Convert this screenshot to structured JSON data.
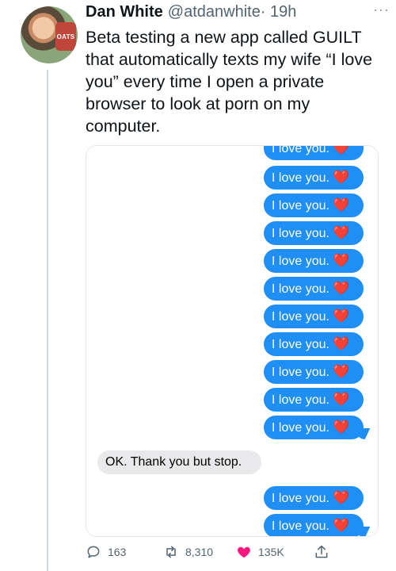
{
  "tweet": {
    "author_name": "Dan White",
    "handle": "@atdanwhite",
    "time": " · 19h",
    "more": "···",
    "text": "Beta testing a new app called GUILT that automatically texts my wife “I love you” every time I open a private browser to look at porn on my computer."
  },
  "avatar": {
    "logo_text": "OATS"
  },
  "messages": {
    "outgoing_text": "I love you.",
    "heart": "❤️",
    "incoming": "OK. Thank you but stop."
  },
  "actions": {
    "replies": "163",
    "retweets": "8,310",
    "likes": "135K"
  },
  "colors": {
    "imessage_blue": "#1f8ef5",
    "incoming_gray": "#e9e9eb",
    "like_pink": "#f91880",
    "icon_gray": "#536471"
  }
}
